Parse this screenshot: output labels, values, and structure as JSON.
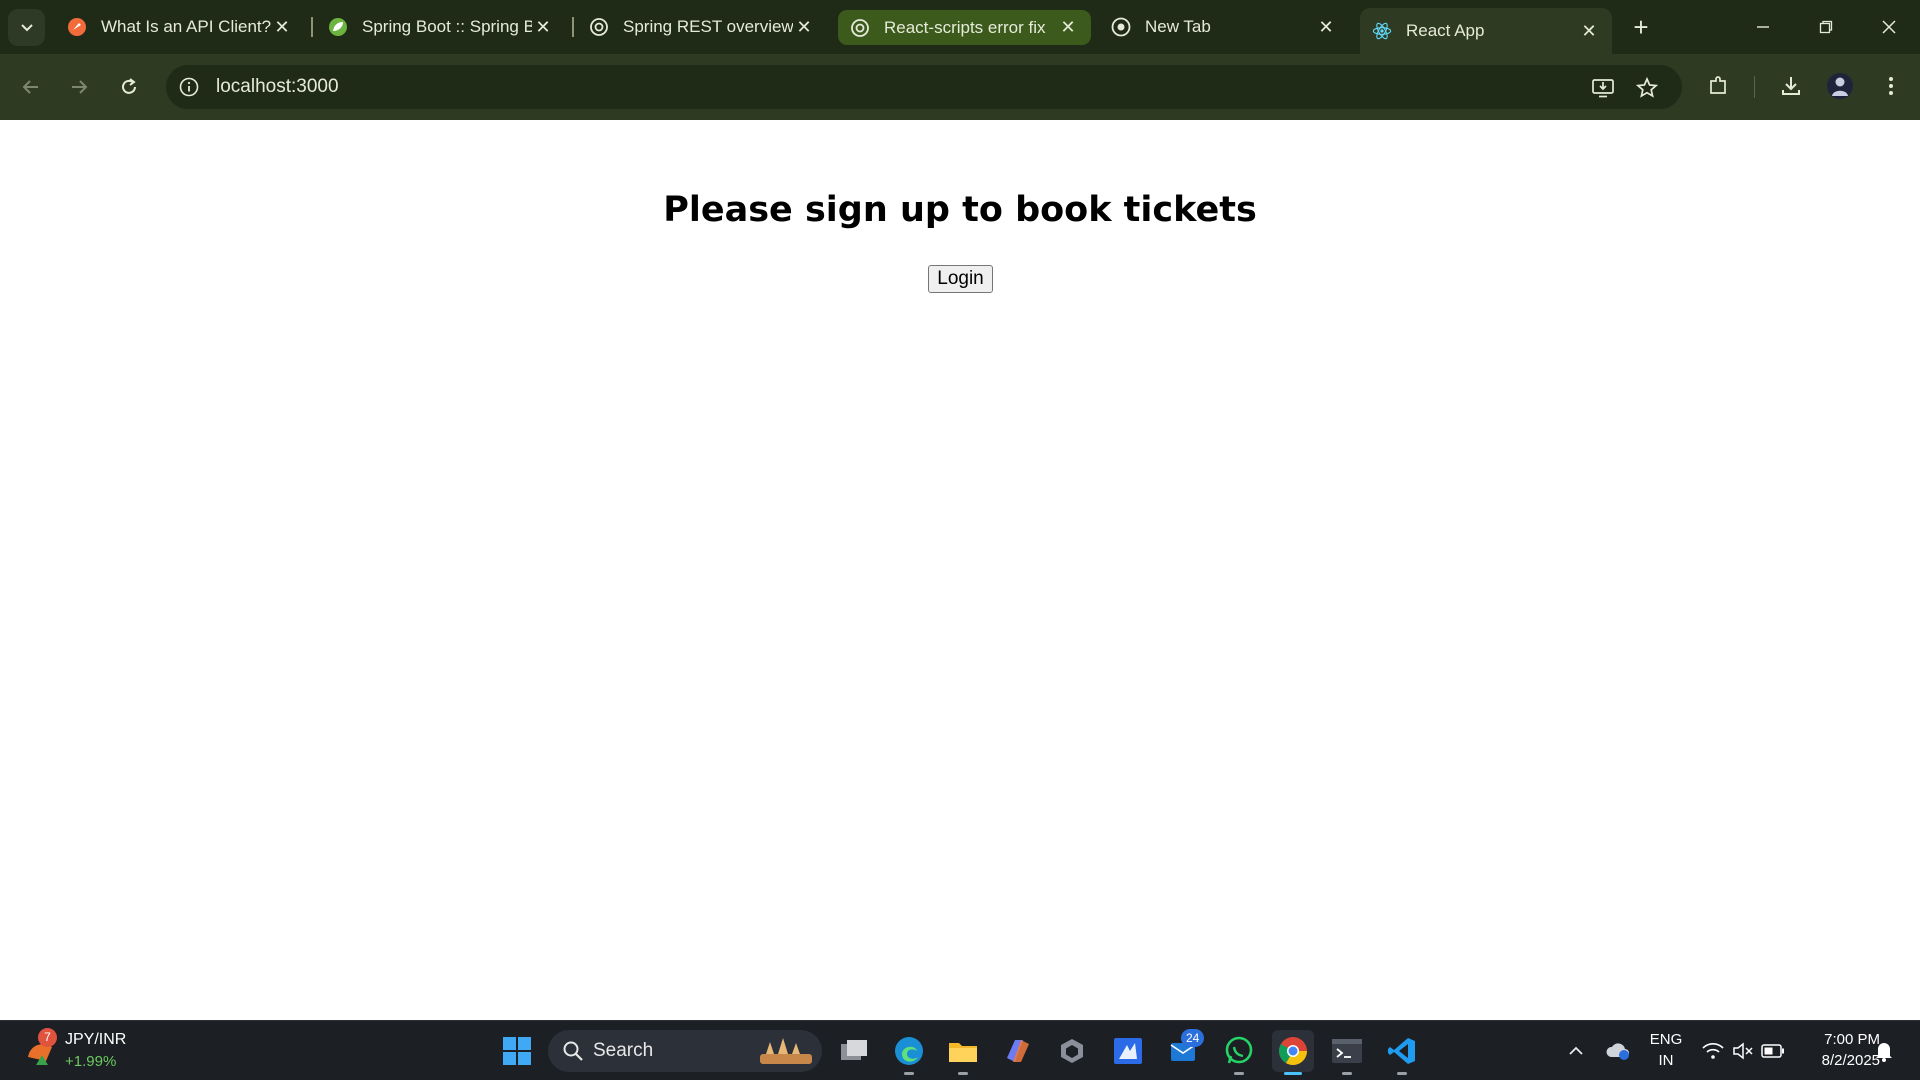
{
  "browser": {
    "tabs": [
      {
        "title": "What Is an API Client?",
        "icon": "postman-icon"
      },
      {
        "title": "Spring Boot :: Spring B",
        "icon": "spring-leaf-icon"
      },
      {
        "title": "Spring REST overview",
        "icon": "chatgpt-icon"
      },
      {
        "title": "React-scripts error fix",
        "icon": "chatgpt-icon"
      },
      {
        "title": "New Tab",
        "icon": "chrome-icon"
      },
      {
        "title": "React App",
        "icon": "react-icon"
      }
    ],
    "active_tab_index": 5,
    "url": "localhost:3000"
  },
  "page": {
    "heading": "Please sign up to book tickets",
    "login_label": "Login"
  },
  "taskbar": {
    "ticker": {
      "name": "JPY/INR",
      "change": "+1.99%",
      "badge": "7"
    },
    "search_label": "Search",
    "mail_badge": "24",
    "lang_line1": "ENG",
    "lang_line2": "IN",
    "time": "7:00 PM",
    "date": "8/2/2025"
  },
  "colors": {
    "chrome_dark": "#1f2a17",
    "chrome_toolbar": "#2e3a22",
    "highlight_tab": "#3b5a1c",
    "taskbar": "#1c1f24",
    "accent_blue": "#4cc2ff"
  }
}
